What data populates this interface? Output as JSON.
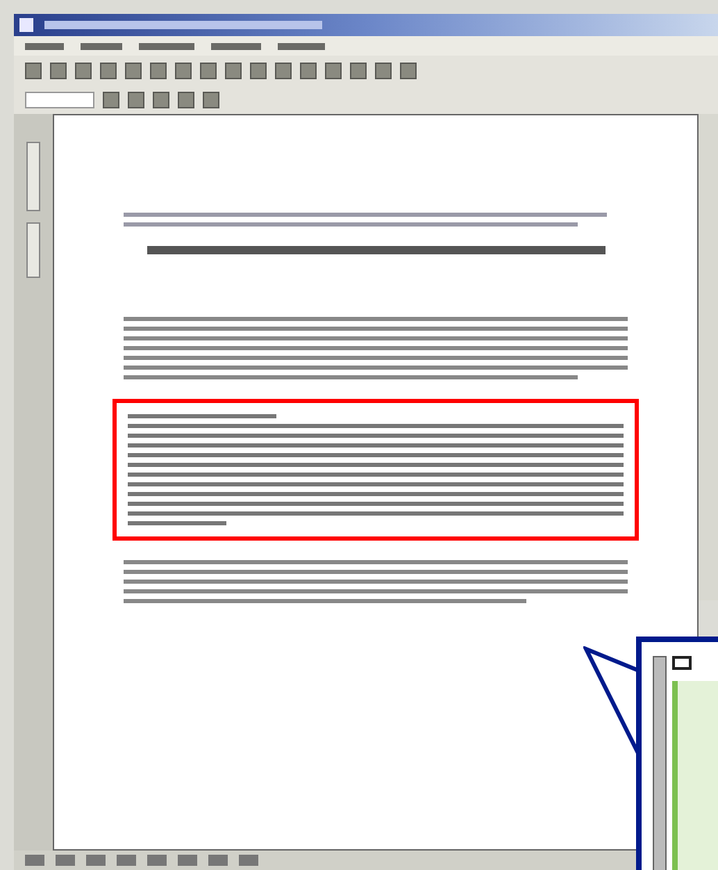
{
  "window": {
    "active": true
  },
  "document": {
    "highlighted": true
  },
  "callout": {
    "shown": true
  }
}
